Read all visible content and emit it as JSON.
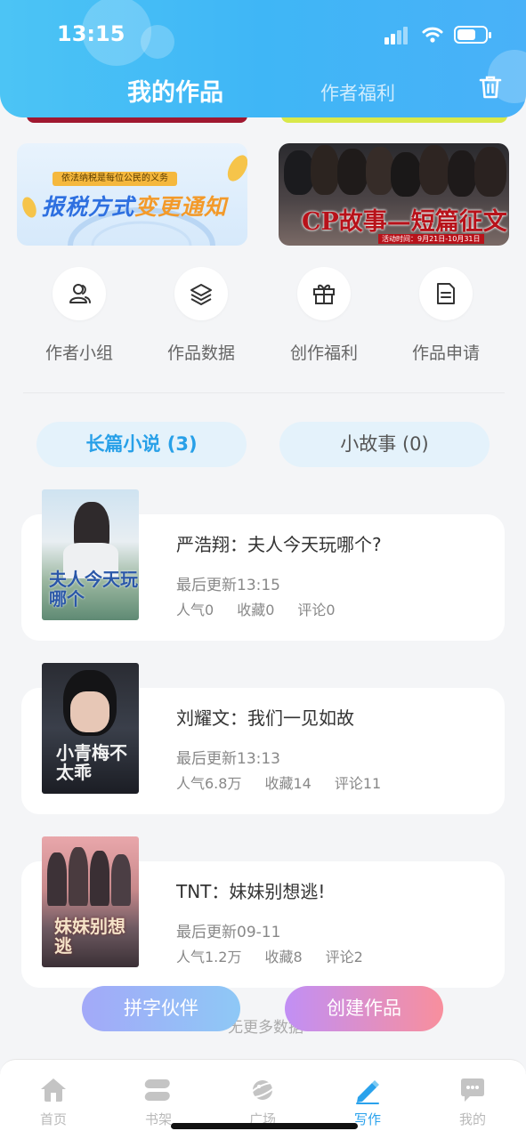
{
  "status": {
    "time": "13:15"
  },
  "header": {
    "tab_active": "我的作品",
    "tab_other": "作者福利",
    "trash_icon": "trash-icon"
  },
  "banners": {
    "tax": {
      "subtitle": "依法纳税是每位公民的义务",
      "title_a": "报税方式",
      "title_b": "变更通知"
    },
    "cp": {
      "title": "CP故事—短篇征文",
      "date": "活动时间：9月21日-10月31日"
    }
  },
  "quick_actions": [
    {
      "label": "作者小组",
      "icon": "author-group-icon"
    },
    {
      "label": "作品数据",
      "icon": "layers-icon"
    },
    {
      "label": "创作福利",
      "icon": "gift-icon"
    },
    {
      "label": "作品申请",
      "icon": "document-icon"
    }
  ],
  "segments": {
    "novel": "长篇小说 (3)",
    "story": "小故事 (0)"
  },
  "works": [
    {
      "title": "严浩翔：夫人今天玩哪个?",
      "updated": "最后更新13:15",
      "popularity": "人气0",
      "favorites": "收藏0",
      "comments": "评论0",
      "cover_text": "夫人今天玩哪个"
    },
    {
      "title": "刘耀文：我们一见如故",
      "updated": "最后更新13:13",
      "popularity": "人气6.8万",
      "favorites": "收藏14",
      "comments": "评论11",
      "cover_text": "小青梅不太乖"
    },
    {
      "title": "TNT：妹妹别想逃!",
      "updated": "最后更新09-11",
      "popularity": "人气1.2万",
      "favorites": "收藏8",
      "comments": "评论2",
      "cover_text": "妹妹别想逃"
    }
  ],
  "footer_text": "无更多数据",
  "floating": {
    "pin": "拼字伙伴",
    "create": "创建作品"
  },
  "nav": [
    {
      "label": "首页",
      "icon": "home-icon"
    },
    {
      "label": "书架",
      "icon": "bookshelf-icon"
    },
    {
      "label": "广场",
      "icon": "planet-icon"
    },
    {
      "label": "写作",
      "icon": "pen-icon",
      "active": true
    },
    {
      "label": "我的",
      "icon": "chat-icon"
    }
  ],
  "colors": {
    "accent": "#2aa2ec",
    "header": "#3fb6f6",
    "cta_start": "#c18ff5",
    "cta_end": "#f88f9d"
  }
}
